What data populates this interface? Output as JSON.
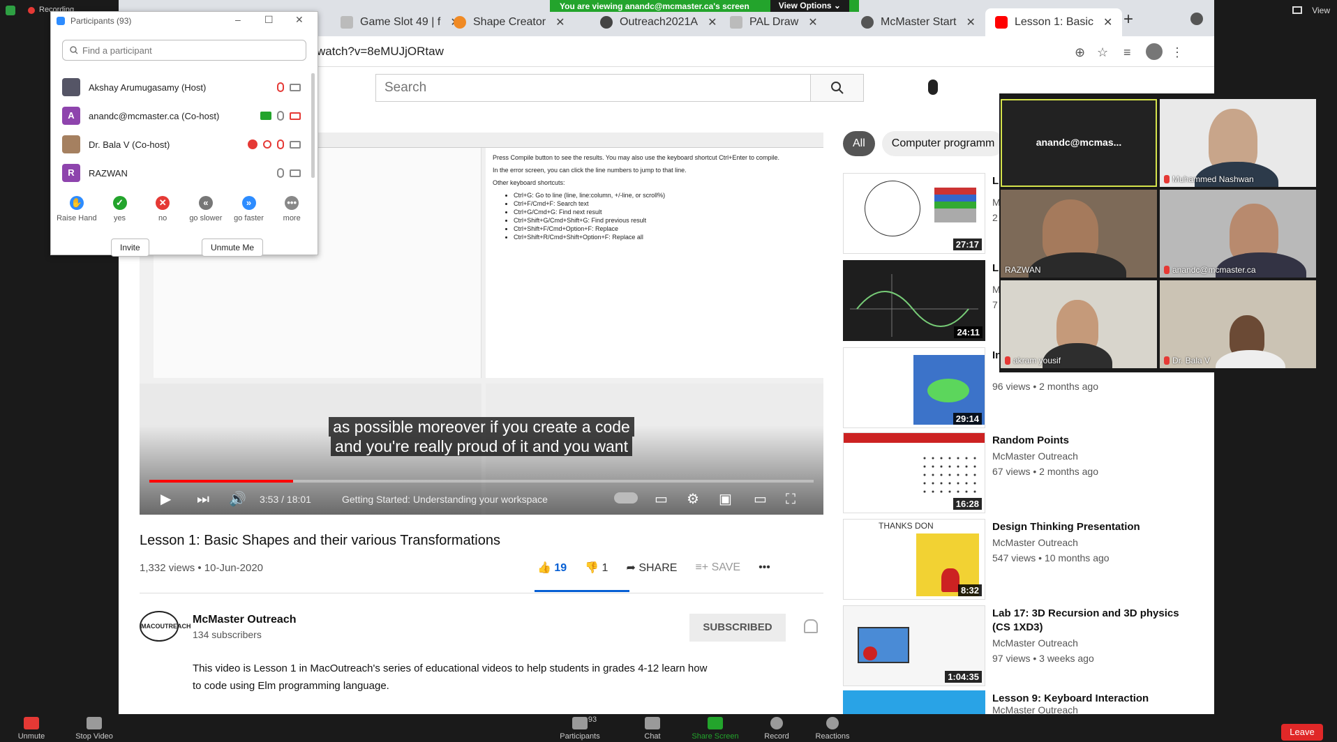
{
  "zoom_top": {
    "recording": "Recording",
    "view": "View"
  },
  "share_banner": {
    "text": "You are viewing anandc@mcmaster.ca's screen",
    "view_options": "View Options"
  },
  "browser": {
    "tabs": [
      {
        "label": "Game Slot 49 | f"
      },
      {
        "label": "Shape Creator"
      },
      {
        "label": "Outreach2021A"
      },
      {
        "label": "PAL Draw"
      },
      {
        "label": "McMaster Start"
      },
      {
        "label": "Lesson 1: Basic"
      }
    ],
    "url": "watch?v=8eMUJjORtaw"
  },
  "youtube": {
    "search_placeholder": "Search",
    "video": {
      "captions": [
        "as possible moreover if you create a code",
        "and you're really proud of it and you want"
      ],
      "time": "3:53 / 18:01",
      "chapter": "Getting Started: Understanding your workspace",
      "progress": 0.216,
      "editor_text": {
        "line1": "Press Compile button to see the results. You may also use the keyboard shortcut Ctrl+Enter to compile.",
        "line2": "In the error screen, you can click the line numbers to jump to that line.",
        "line3": "Other keyboard shortcuts:",
        "shortcuts": [
          "Ctrl+G: Go to line (line, line:column, +/-line, or scroll%)",
          "Ctrl+F/Cmd+F: Search text",
          "Ctrl+G/Cmd+G: Find next result",
          "Ctrl+Shift+G/Cmd+Shift+G: Find previous result",
          "Ctrl+Shift+F/Cmd+Option+F: Replace",
          "Ctrl+Shift+R/Cmd+Shift+Option+F: Replace all"
        ]
      }
    },
    "title": "Lesson 1: Basic Shapes and their various Transformations",
    "views": "1,332 views • 10-Jun-2020",
    "likes": "19",
    "dislikes": "1",
    "share": "SHARE",
    "save": "SAVE",
    "channel": {
      "name": "McMaster Outreach",
      "subscribers": "134 subscribers",
      "logo_text": "MACOUTREACH",
      "subscribed": "SUBSCRIBED"
    },
    "description": "This video is Lesson 1 in MacOutreach's series of educational videos to help students in grades 4-12 learn how to code using Elm programming language.",
    "chips": [
      "All",
      "Computer programm"
    ],
    "recommendations": [
      {
        "title": "L",
        "channel": "M",
        "views": "2",
        "duration": "27:17"
      },
      {
        "title": "L",
        "channel": "M",
        "views": "7",
        "duration": "24:11"
      },
      {
        "title": "In",
        "channel": "",
        "views": "96 views • 2 months ago",
        "duration": "29:14"
      },
      {
        "title": "Random Points",
        "channel": "McMaster Outreach",
        "views": "67 views • 2 months ago",
        "duration": "16:28"
      },
      {
        "title": "Design Thinking Presentation",
        "channel": "McMaster Outreach",
        "views": "547 views • 10 months ago",
        "duration": "8:32",
        "thumb_text": "THANKS DON"
      },
      {
        "title": "Lab 17: 3D Recursion and 3D physics (CS 1XD3)",
        "channel": "McMaster Outreach",
        "views": "97 views • 3 weeks ago",
        "duration": "1:04:35"
      },
      {
        "title": "Lesson 9: Keyboard Interaction",
        "channel": "McMaster Outreach",
        "views": "",
        "duration": ""
      }
    ]
  },
  "gallery": {
    "tiles": [
      {
        "name": "anandc@mcmas..."
      },
      {
        "name": "Muhammed Nashwan"
      },
      {
        "name": "RAZWAN"
      },
      {
        "name": "anandc@mcmaster.ca"
      },
      {
        "name": "akram yousif"
      },
      {
        "name": "Dr. Bala V"
      }
    ]
  },
  "participants": {
    "title": "Participants (93)",
    "search_placeholder": "Find a participant",
    "list": [
      {
        "name": "Akshay Arumugasamy (Host)",
        "initial": ""
      },
      {
        "name": "anandc@mcmaster.ca (Co-host)",
        "initial": "A"
      },
      {
        "name": "Dr. Bala V (Co-host)",
        "initial": ""
      },
      {
        "name": "RAZWAN",
        "initial": "R"
      }
    ],
    "reactions": [
      {
        "label": "Raise Hand"
      },
      {
        "label": "yes"
      },
      {
        "label": "no"
      },
      {
        "label": "go slower"
      },
      {
        "label": "go faster"
      },
      {
        "label": "more"
      }
    ],
    "invite": "Invite",
    "unmute_me": "Unmute Me"
  },
  "zoom_bottom": {
    "unmute": "Unmute",
    "stop_video": "Stop Video",
    "participants": "Participants",
    "participants_count": "93",
    "chat": "Chat",
    "share_screen": "Share Screen",
    "record": "Record",
    "reactions": "Reactions",
    "leave": "Leave"
  }
}
